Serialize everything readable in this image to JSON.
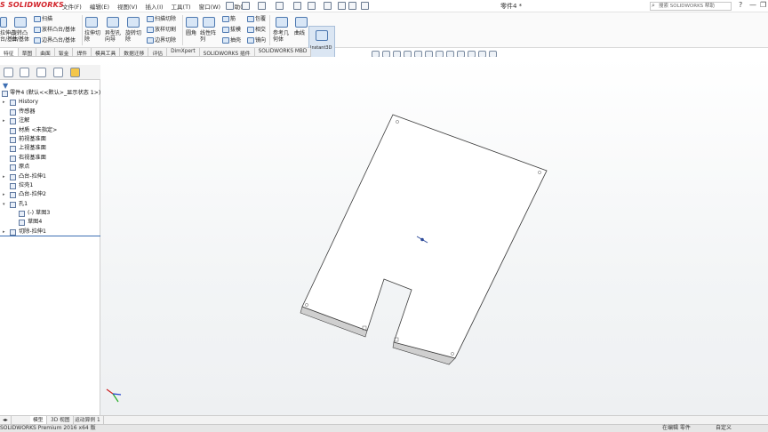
{
  "app": {
    "logo": "S SOLIDWORKS",
    "doc_title": "零件4 *"
  },
  "menu": [
    "文件(F)",
    "编辑(E)",
    "视图(V)",
    "插入(I)",
    "工具(T)",
    "窗口(W)",
    "帮助(H)"
  ],
  "search": {
    "placeholder": "搜索 SOLIDWORKS 帮助"
  },
  "window_controls": [
    "?",
    "—",
    "❐",
    "✕"
  ],
  "ribbon": {
    "left_partial": [
      "拉伸凸",
      "台/基体"
    ],
    "revolve": [
      "旋转凸",
      "台/基体"
    ],
    "sweep": "扫描",
    "loft": "放样凸台/基体",
    "boundary": "边界凸台/基体",
    "extrude_cut": [
      "拉伸切",
      "除"
    ],
    "hole_wizard": [
      "异型孔",
      "向导"
    ],
    "revolve_cut": [
      "旋转切",
      "除"
    ],
    "swept_cut": "扫描切除",
    "lofted_cut": "放样切割",
    "boundary_cut": "边界切除",
    "fillet": "圆角",
    "linear_pattern": [
      "线性阵",
      "列"
    ],
    "rib": "筋",
    "draft": "拔模",
    "shell": "抽壳",
    "wrap": "包覆",
    "intersect": "相交",
    "mirror": "镜向",
    "ref_geometry": [
      "参考几",
      "何体"
    ],
    "curves": "曲线",
    "instant3d": "Instant3D"
  },
  "command_tabs": [
    "特征",
    "草图",
    "曲面",
    "钣金",
    "焊件",
    "模具工具",
    "数据迁移",
    "评估",
    "DimXpert",
    "SOLIDWORKS 插件",
    "SOLIDWORKS MBD"
  ],
  "tree": {
    "root": "零件4 (默认<<默认>_显示状态 1>)",
    "nodes": [
      {
        "label": "History",
        "twisty": "▸",
        "icon": "history-icon"
      },
      {
        "label": "传感器",
        "twisty": "",
        "icon": "sensor-icon"
      },
      {
        "label": "注解",
        "twisty": "▸",
        "icon": "annotation-icon"
      },
      {
        "label": "材质 <未指定>",
        "twisty": "",
        "icon": "material-icon"
      },
      {
        "label": "前视基准面",
        "twisty": "",
        "icon": "plane-icon"
      },
      {
        "label": "上视基准面",
        "twisty": "",
        "icon": "plane-icon"
      },
      {
        "label": "右视基准面",
        "twisty": "",
        "icon": "plane-icon"
      },
      {
        "label": "原点",
        "twisty": "",
        "icon": "origin-icon"
      },
      {
        "label": "凸台-拉伸1",
        "twisty": "▸",
        "icon": "extrude-icon"
      },
      {
        "label": "拉壳1",
        "twisty": "",
        "icon": "shell-feature-icon"
      },
      {
        "label": "凸台-拉伸2",
        "twisty": "▸",
        "icon": "extrude-icon"
      },
      {
        "label": "孔1",
        "twisty": "▾",
        "icon": "hole-icon"
      },
      {
        "label": "(-) 草图3",
        "twisty": "",
        "icon": "sketch-icon"
      },
      {
        "label": "草图4",
        "twisty": "",
        "icon": "sketch-icon"
      },
      {
        "label": "切除-拉伸1",
        "twisty": "▸",
        "icon": "cut-extrude-icon"
      }
    ]
  },
  "bottom_tabs": [
    "模型",
    "3D 视图",
    "运动算例 1"
  ],
  "status": {
    "left": "SOLIDWORKS Premium 2016 x64 版",
    "mode": "在编辑 零件",
    "units": "自定义"
  },
  "colors": {
    "logo_red": "#d2232a",
    "selection_blue": "#3d6fb3",
    "side_face": "#b7a2bd"
  }
}
